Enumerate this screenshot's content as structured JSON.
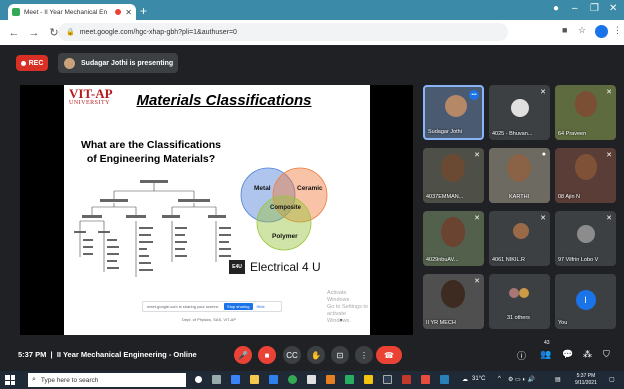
{
  "browser": {
    "tab_title": "Meet - II Year Mechanical En",
    "url": "meet.google.com/hgc-xhap-gbh?pli=1&authuser=0"
  },
  "meet": {
    "rec_label": "REC",
    "presenting_text": "Sudagar Jothi is presenting",
    "meeting_time": "5:37 PM",
    "meeting_title": "II Year Mechanical Engineering - Online",
    "participants_badge": "43"
  },
  "slide": {
    "logo_main": "VIT-AP",
    "logo_sub": "UNIVERSITY",
    "title": "Materials Classifications",
    "question_line1": "What are the Classifications",
    "question_line2": "of Engineering Materials?",
    "venn": {
      "metal": "Metal",
      "ceramic": "Ceramic",
      "composite": "Composite",
      "polymer": "Polymer"
    },
    "elec_logo": "E4U",
    "elec_text": "Electrical 4 U",
    "share_text": "meet.google.com is sharing your screen.",
    "stop_label": "Stop sharing",
    "hide_label": "Hide",
    "footer": "Dept. of Physics, SAS, VIT-AP",
    "activate_l1": "Activate Windows",
    "activate_l2": "Go to Settings to activate Windows."
  },
  "participants": [
    {
      "name": "Sudagar Jothi"
    },
    {
      "name": "4025 - Bhuvan..."
    },
    {
      "name": "64 Praveen"
    },
    {
      "name": "4037EMMAN..."
    },
    {
      "name": "KARTHI"
    },
    {
      "name": "08 Ajin N"
    },
    {
      "name": "4029nbuAV..."
    },
    {
      "name": "4061 NIKIL.R"
    },
    {
      "name": "97 Vilfrin Lobo V"
    },
    {
      "name": "II YR MECH"
    },
    {
      "name": "31 others"
    },
    {
      "name": "You",
      "initial": "I"
    }
  ],
  "taskbar": {
    "search_placeholder": "Type here to search",
    "weather": "31°C",
    "time": "5:37 PM",
    "date": "9/11/2021"
  }
}
